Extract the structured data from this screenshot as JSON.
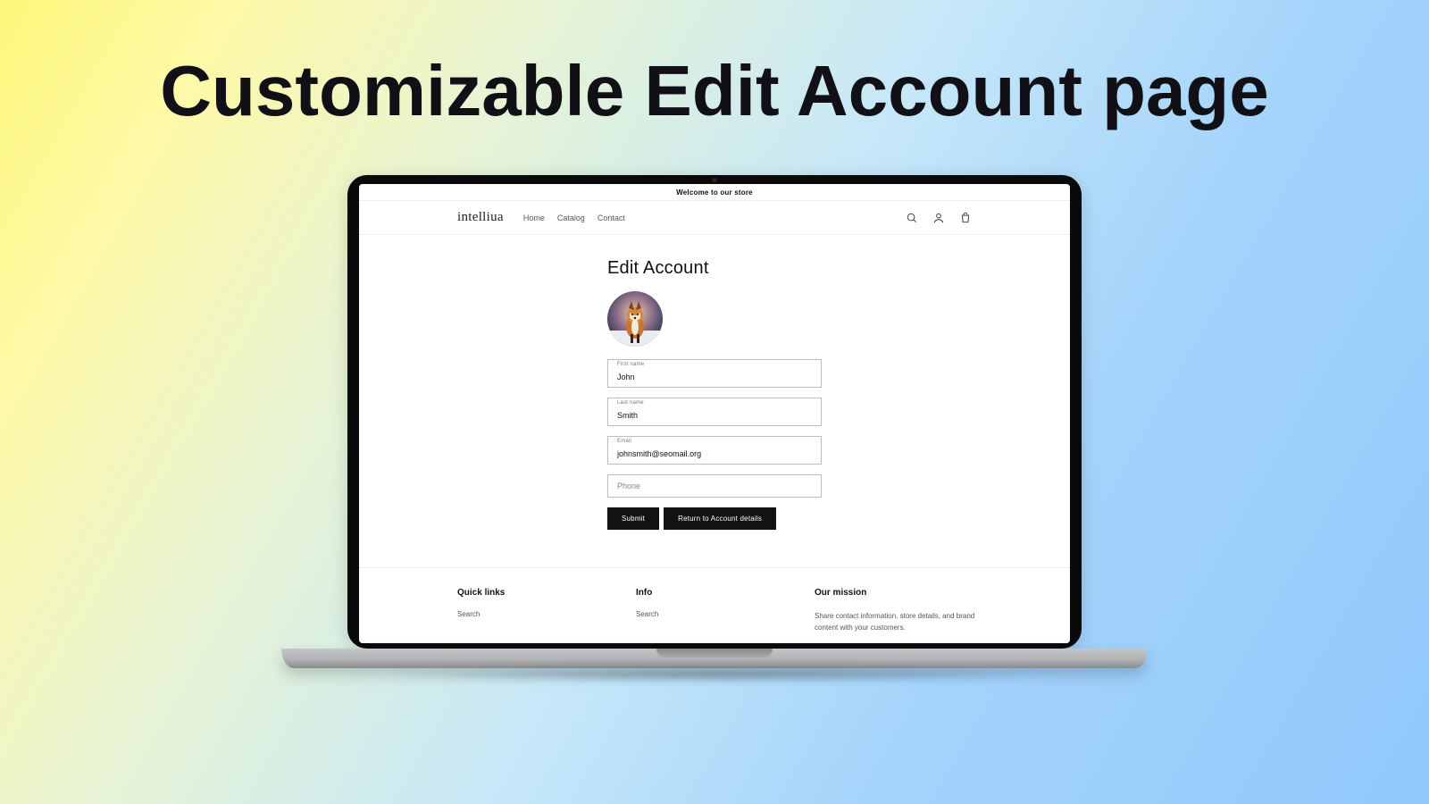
{
  "promo": {
    "headline": "Customizable Edit Account page"
  },
  "announcement_bar": "Welcome to our store",
  "brand": "intelliua",
  "nav": {
    "items": [
      "Home",
      "Catalog",
      "Contact"
    ]
  },
  "header_icons": {
    "search": "search-icon",
    "account": "account-icon",
    "cart": "cart-icon"
  },
  "page": {
    "title": "Edit Account",
    "form": {
      "first_name": {
        "label": "First name",
        "value": "John"
      },
      "last_name": {
        "label": "Last name",
        "value": "Smith"
      },
      "email": {
        "label": "Email",
        "value": "johnsmith@seomail.org"
      },
      "phone": {
        "placeholder": "Phone",
        "value": ""
      }
    },
    "actions": {
      "submit": "Submit",
      "return": "Return to Account details"
    }
  },
  "footer": {
    "col1": {
      "title": "Quick links",
      "links": [
        "Search"
      ]
    },
    "col2": {
      "title": "Info",
      "links": [
        "Search"
      ]
    },
    "col3": {
      "title": "Our mission",
      "text": "Share contact information, store details, and brand content with your customers."
    }
  }
}
